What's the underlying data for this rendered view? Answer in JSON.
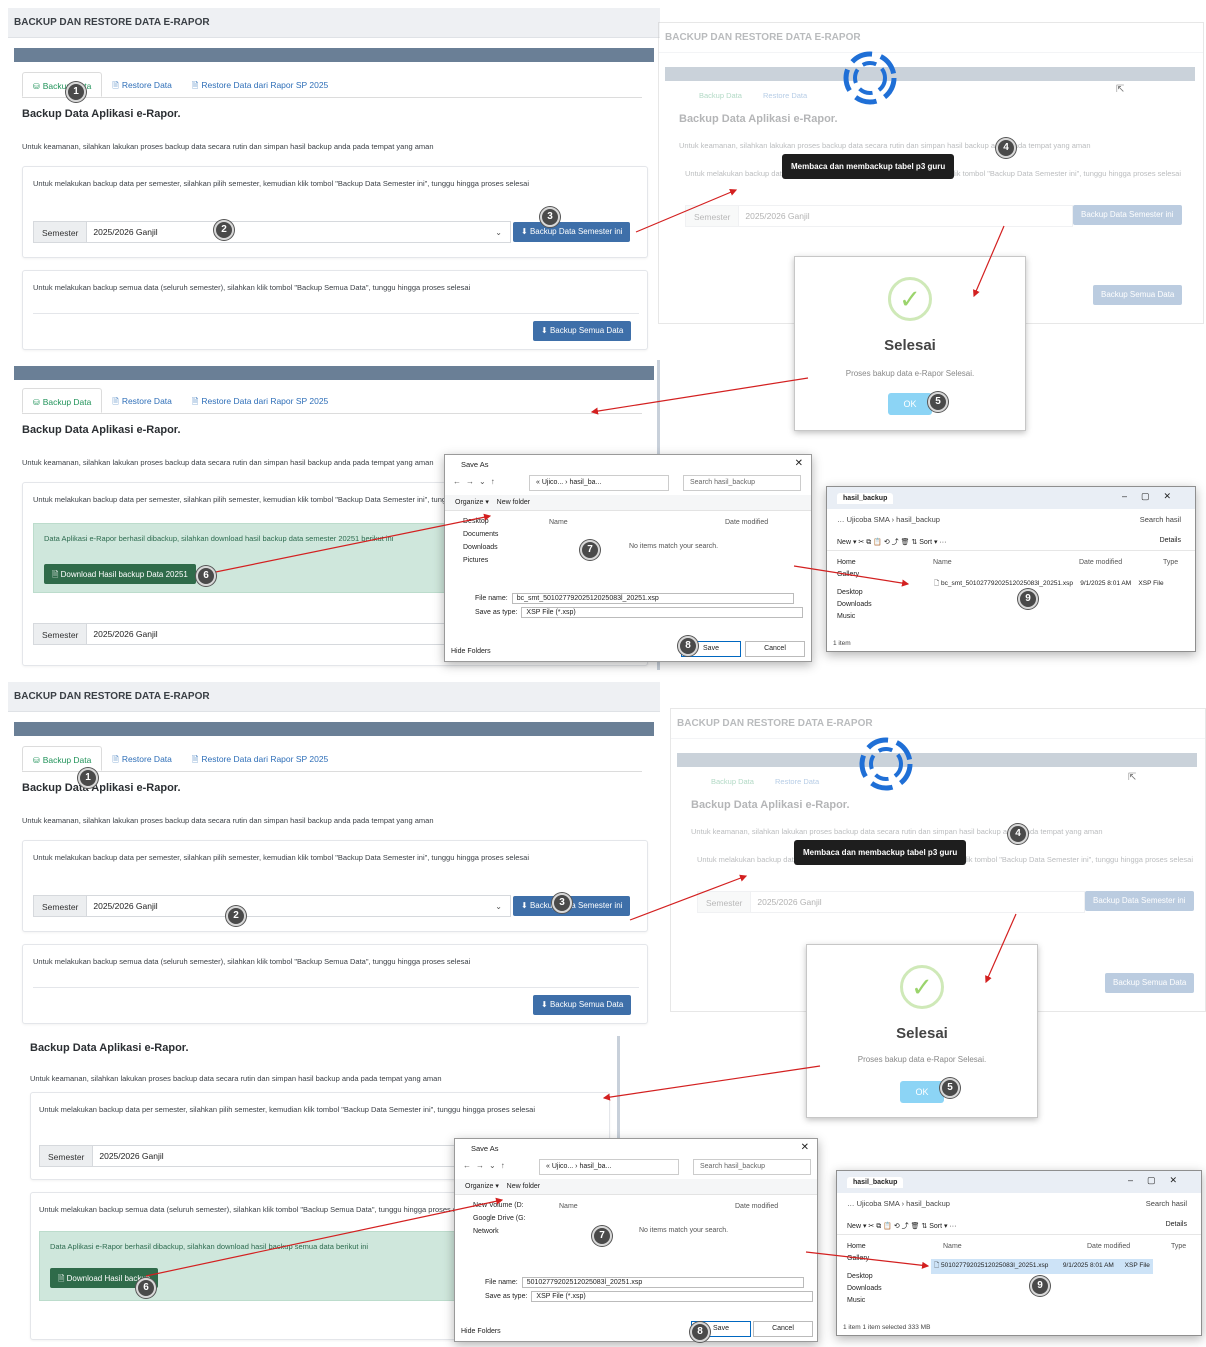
{
  "page": {
    "title": "BACKUP DAN RESTORE DATA E-RAPOR",
    "tabs": [
      "Backup Data",
      "Restore Data",
      "Restore Data dari Rapor SP 2025"
    ],
    "heading": "Backup Data Aplikasi e-Rapor.",
    "intro": "Untuk keamanan, silahkan lakukan proses backup data secara rutin dan simpan hasil backup anda pada tempat yang aman",
    "semester_info": "Untuk melakukan backup data per semester, silahkan pilih semester, kemudian klik tombol \"Backup Data Semester ini\", tunggu hingga proses selesai",
    "semester_label": "Semester",
    "semester_value": "2025/2026 Ganjil",
    "btn_semester": "Backup Data Semester ini",
    "all_info": "Untuk melakukan backup semua data (seluruh semester), silahkan klik tombol \"Backup Semua Data\", tunggu hingga proses selesai",
    "btn_all": "Backup Semua Data"
  },
  "tooltip": "Membaca dan membackup tabel p3 guru",
  "modal": {
    "title": "Selesai",
    "message": "Proses bakup data e-Rapor Selesai.",
    "ok": "OK"
  },
  "alert_semester": "Data Aplikasi e-Rapor berhasil dibackup, silahkan download hasil backup data semester 20251 berikut ini",
  "btn_download_semester": "Download Hasil backup Data 20251",
  "alert_all": "Data Aplikasi e-Rapor berhasil dibackup, silahkan download hasil backup semua data berikut ini",
  "btn_download_all": "Download Hasil backup",
  "save_as_1": {
    "title": "Save As",
    "path": "« Ujico... › hasil_ba...",
    "search": "Search hasil_backup",
    "organize": "Organize ▾",
    "new_folder": "New folder",
    "sidebar": [
      "Desktop",
      "Documents",
      "Downloads",
      "Pictures"
    ],
    "col_name": "Name",
    "col_date": "Date modified",
    "empty": "No items match your search.",
    "file_name_label": "File name:",
    "file_name": "bc_smt_50102779202512025083l_20251.xsp",
    "type_label": "Save as type:",
    "type": "XSP File (*.xsp)",
    "hide": "Hide Folders",
    "save": "Save",
    "cancel": "Cancel"
  },
  "save_as_2": {
    "title": "Save As",
    "path": "« Ujico... › hasil_ba...",
    "search": "Search hasil_backup",
    "organize": "Organize ▾",
    "new_folder": "New folder",
    "sidebar": [
      "New Volume (D:",
      "Google Drive (G:",
      "Network"
    ],
    "col_name": "Name",
    "col_date": "Date modified",
    "empty": "No items match your search.",
    "file_name_label": "File name:",
    "file_name": "50102779202512025083l_20251.xsp",
    "type_label": "Save as type:",
    "type": "XSP File (*.xsp)",
    "hide": "Hide Folders",
    "save": "Save",
    "cancel": "Cancel"
  },
  "explorer_1": {
    "tab": "hasil_backup",
    "path": "…  Ujicoba SMA  ›  hasil_backup",
    "search": "Search hasil",
    "toolbar": "New ▾      ✂      ⧉      📋      ⟲      ⤴      🗑      ⇅ Sort ▾      ···",
    "details": "Details",
    "nav": [
      "Home",
      "Gallery",
      "Desktop",
      "Downloads",
      "Music"
    ],
    "cols": [
      "Name",
      "Date modified",
      "Type"
    ],
    "file": "bc_smt_50102779202512025083l_20251.xsp",
    "date": "9/1/2025 8:01 AM",
    "type": "XSP File",
    "status": "1 item"
  },
  "explorer_2": {
    "tab": "hasil_backup",
    "path": "…  Ujicoba SMA  ›  hasil_backup",
    "search": "Search hasil",
    "toolbar": "New ▾      ✂      ⧉      📋      ⟲      ⤴      🗑      ⇅ Sort ▾      ···",
    "details": "Details",
    "nav": [
      "Home",
      "Gallery",
      "Desktop",
      "Downloads",
      "Music"
    ],
    "cols": [
      "Name",
      "Date modified",
      "Type"
    ],
    "file": "50102779202512025083l_20251.xsp",
    "date": "9/1/2025 8:01 AM",
    "type": "XSP File",
    "status": "1 item    1 item selected  333 MB"
  },
  "markers": [
    "1",
    "2",
    "3",
    "4",
    "5",
    "6",
    "7",
    "8",
    "9"
  ],
  "colors": {
    "accent": "#3e6fa9",
    "band": "#6a7f96",
    "arrow": "#d32020",
    "success": "#cfe7dc"
  }
}
